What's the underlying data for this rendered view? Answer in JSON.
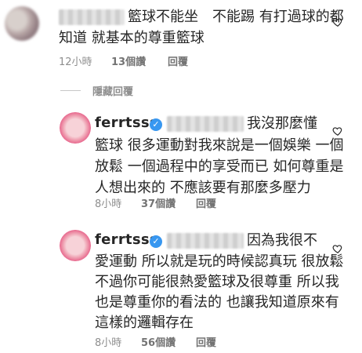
{
  "comments": [
    {
      "text": "籃球不能坐　不能踢 有打過球的都",
      "text2": "知道 就基本的尊重籃球",
      "time": "12小時",
      "likes": "13個讚",
      "reply": "回覆"
    }
  ],
  "hidden_replies_label": "隱藏回覆",
  "replies": [
    {
      "username": "ferrtsss",
      "lines": [
        "我沒那麼懂",
        "籃球 很多運動對我來說是一個娛樂 一個",
        "放鬆 一個過程中的享受而已 如何尊重是",
        "人想出來的 不應該要有那麼多壓力"
      ],
      "time": "8小時",
      "likes": "37個讚",
      "reply": "回覆"
    },
    {
      "username": "ferrtsss",
      "lines": [
        "因為我很不",
        "愛運動 所以就是玩的時候認真玩 很放鬆",
        "不過你可能很熱愛籃球及很尊重 所以我",
        "也是尊重你的看法的 也讓我知道原來有",
        "這樣的邏輯存在"
      ],
      "time": "8小時",
      "likes": "56個讚",
      "reply": "回覆"
    }
  ]
}
